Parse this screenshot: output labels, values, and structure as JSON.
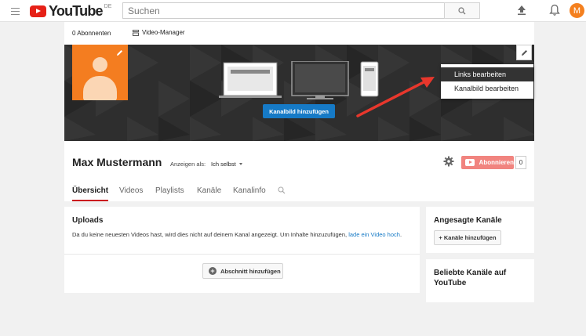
{
  "masthead": {
    "logo_text": "YouTube",
    "logo_region": "DE",
    "search_placeholder": "Suchen",
    "avatar_letter": "M",
    "avatar_color": "#f4801f"
  },
  "channel": {
    "subscribers": "0 Abonnenten",
    "video_manager": "Video-Manager",
    "add_channel_art": "Kanalbild hinzufügen",
    "title": "Max Mustermann",
    "view_as_label": "Anzeigen als:",
    "view_as_value": "Ich selbst",
    "subscribe_label": "Abonnieren",
    "subscribe_count": "0"
  },
  "dropdown": {
    "items": [
      {
        "label": "Links bearbeiten",
        "active": true
      },
      {
        "label": "Kanalbild bearbeiten",
        "active": false
      }
    ]
  },
  "tabs": [
    {
      "label": "Übersicht",
      "active": true
    },
    {
      "label": "Videos",
      "active": false
    },
    {
      "label": "Playlists",
      "active": false
    },
    {
      "label": "Kanäle",
      "active": false
    },
    {
      "label": "Kanalinfo",
      "active": false
    }
  ],
  "uploads": {
    "title": "Uploads",
    "text": "Da du keine neuesten Videos hast, wird dies nicht auf deinem Kanal angezeigt. Um Inhalte hinzuzufügen,",
    "link": "lade ein Video hoch",
    "text_end": ".",
    "add_section": "Abschnitt hinzufügen"
  },
  "sidebar": {
    "featured_title": "Angesagte Kanäle",
    "featured_button": "+ Kanäle hinzufügen",
    "popular_title": "Beliebte Kanäle auf YouTube"
  },
  "colors": {
    "brand_red": "#e62117",
    "accent_blue": "#167ac6",
    "annotation_arrow": "#e8372c"
  },
  "icons": [
    "menu-icon",
    "search-icon",
    "upload-icon",
    "bell-icon",
    "pencil-icon",
    "gear-icon",
    "video-manager-icon",
    "plus-icon"
  ]
}
